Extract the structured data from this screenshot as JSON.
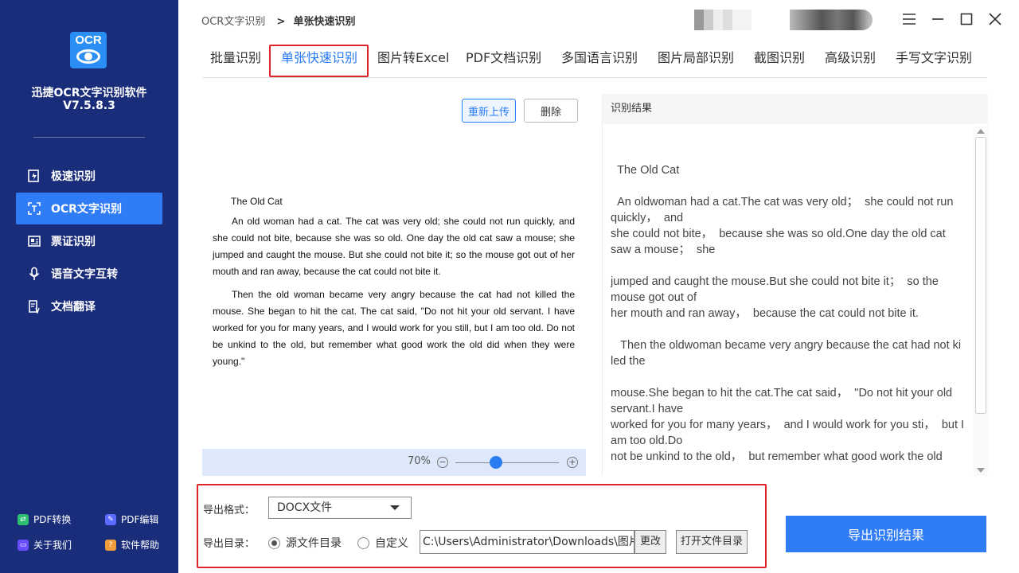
{
  "app": {
    "logo_text": "OCR",
    "name": "迅捷OCR文字识别软件",
    "version": "V7.5.8.3"
  },
  "nav": [
    {
      "label": "极速识别",
      "icon": "lightning-icon"
    },
    {
      "label": "OCR文字识别",
      "icon": "scan-icon"
    },
    {
      "label": "票证识别",
      "icon": "ticket-icon"
    },
    {
      "label": "语音文字互转",
      "icon": "microphone-icon"
    },
    {
      "label": "文档翻译",
      "icon": "translate-icon"
    }
  ],
  "bottom_links": [
    {
      "label": "PDF转换",
      "color": "#2dbf6f"
    },
    {
      "label": "PDF编辑",
      "color": "#5b6bff"
    },
    {
      "label": "关于我们",
      "color": "#6a4cff"
    },
    {
      "label": "软件帮助",
      "color": "#f19d3c"
    }
  ],
  "breadcrumb": {
    "parent": "OCR文字识别",
    "separator": ">",
    "current": "单张快速识别"
  },
  "tabs": [
    "批量识别",
    "单张快速识别",
    "图片转Excel",
    "PDF文档识别",
    "多国语言识别",
    "图片局部识别",
    "截图识别",
    "高级识别",
    "手写文字识别"
  ],
  "active_tab": "单张快速识别",
  "preview": {
    "reupload_label": "重新上传",
    "delete_label": "删除",
    "doc_title": "The Old Cat",
    "doc_paragraphs": [
      "An old woman had a cat. The cat was very old; she could not run quickly, and she could not bite, because she was so old. One day the old cat saw a mouse; she jumped and caught the mouse. But she could not bite it; so the mouse got out of her mouth and ran away, because the cat could not bite it.",
      "Then the old woman became very angry because the cat had not killed the mouse. She began to hit the cat. The cat said, \"Do not hit your old servant. I have worked for you for many years, and I would work for you still, but I am too old. Do not be unkind to the old, but remember what good work the old did when they were young.\""
    ],
    "zoom": "70%",
    "zoom_fraction": 0.39
  },
  "result": {
    "header": "识别结果",
    "lines": [
      "  The Old Cat",
      "",
      "  An oldwoman had a cat.The cat was very old；  she could not run quickly，  and",
      "she could not bite，  because she was so old.One day the old cat saw a mouse；  she",
      "",
      "jumped and caught the mouse.But she could not bite it；  so the mouse got out of",
      "her mouth and ran away，  because the cat could not bite it.",
      "",
      "   Then the oldwoman became very angry because the cat had not ki led the",
      "",
      "mouse.She began to hit the cat.The cat said，  \"Do not hit your old servant.I have",
      "worked for you for many years，  and I would work for you sti，  but I am too old.Do",
      "not be unkind to the old，  but remember what good work the old"
    ]
  },
  "export": {
    "format_label": "导出格式：",
    "format_value": "DOCX文件",
    "dir_label": "导出目录：",
    "radio_source": "源文件目录",
    "radio_custom": "自定义",
    "path": "C:\\Users\\Administrator\\Downloads\\图片",
    "change_label": "更改",
    "open_label": "打开文件目录",
    "export_button": "导出识别结果"
  },
  "colors": {
    "sidebar": "#1a2d7a",
    "accent": "#2f7cf6",
    "highlight": "#e0252a"
  }
}
